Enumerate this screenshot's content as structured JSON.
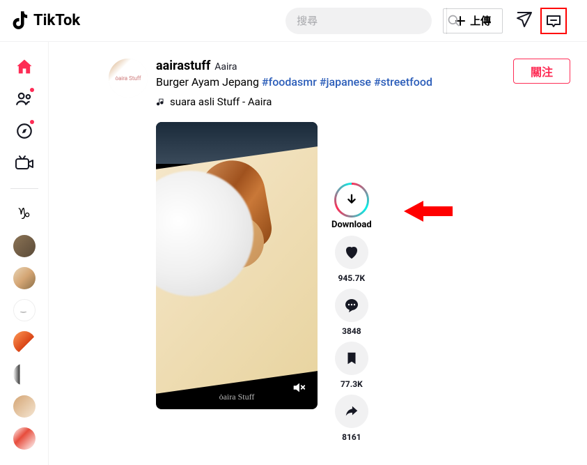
{
  "brand": "TikTok",
  "header": {
    "search_placeholder": "搜尋",
    "upload_label": "上傳"
  },
  "video": {
    "author_username": "aairastuff",
    "author_name": "Aaira",
    "caption_text": "Burger Ayam Jepang",
    "hashtags": [
      "#foodasmr",
      "#japanese",
      "#streetfood"
    ],
    "music_label": "suara asli Stuff - Aaira",
    "follow_label": "關注",
    "watermark": "ȯaira Stuff",
    "profile_badge": "ȯaira Stuff"
  },
  "actions": {
    "download_label": "Download",
    "likes": "945.7K",
    "comments": "3848",
    "saves": "77.3K",
    "shares": "8161"
  }
}
